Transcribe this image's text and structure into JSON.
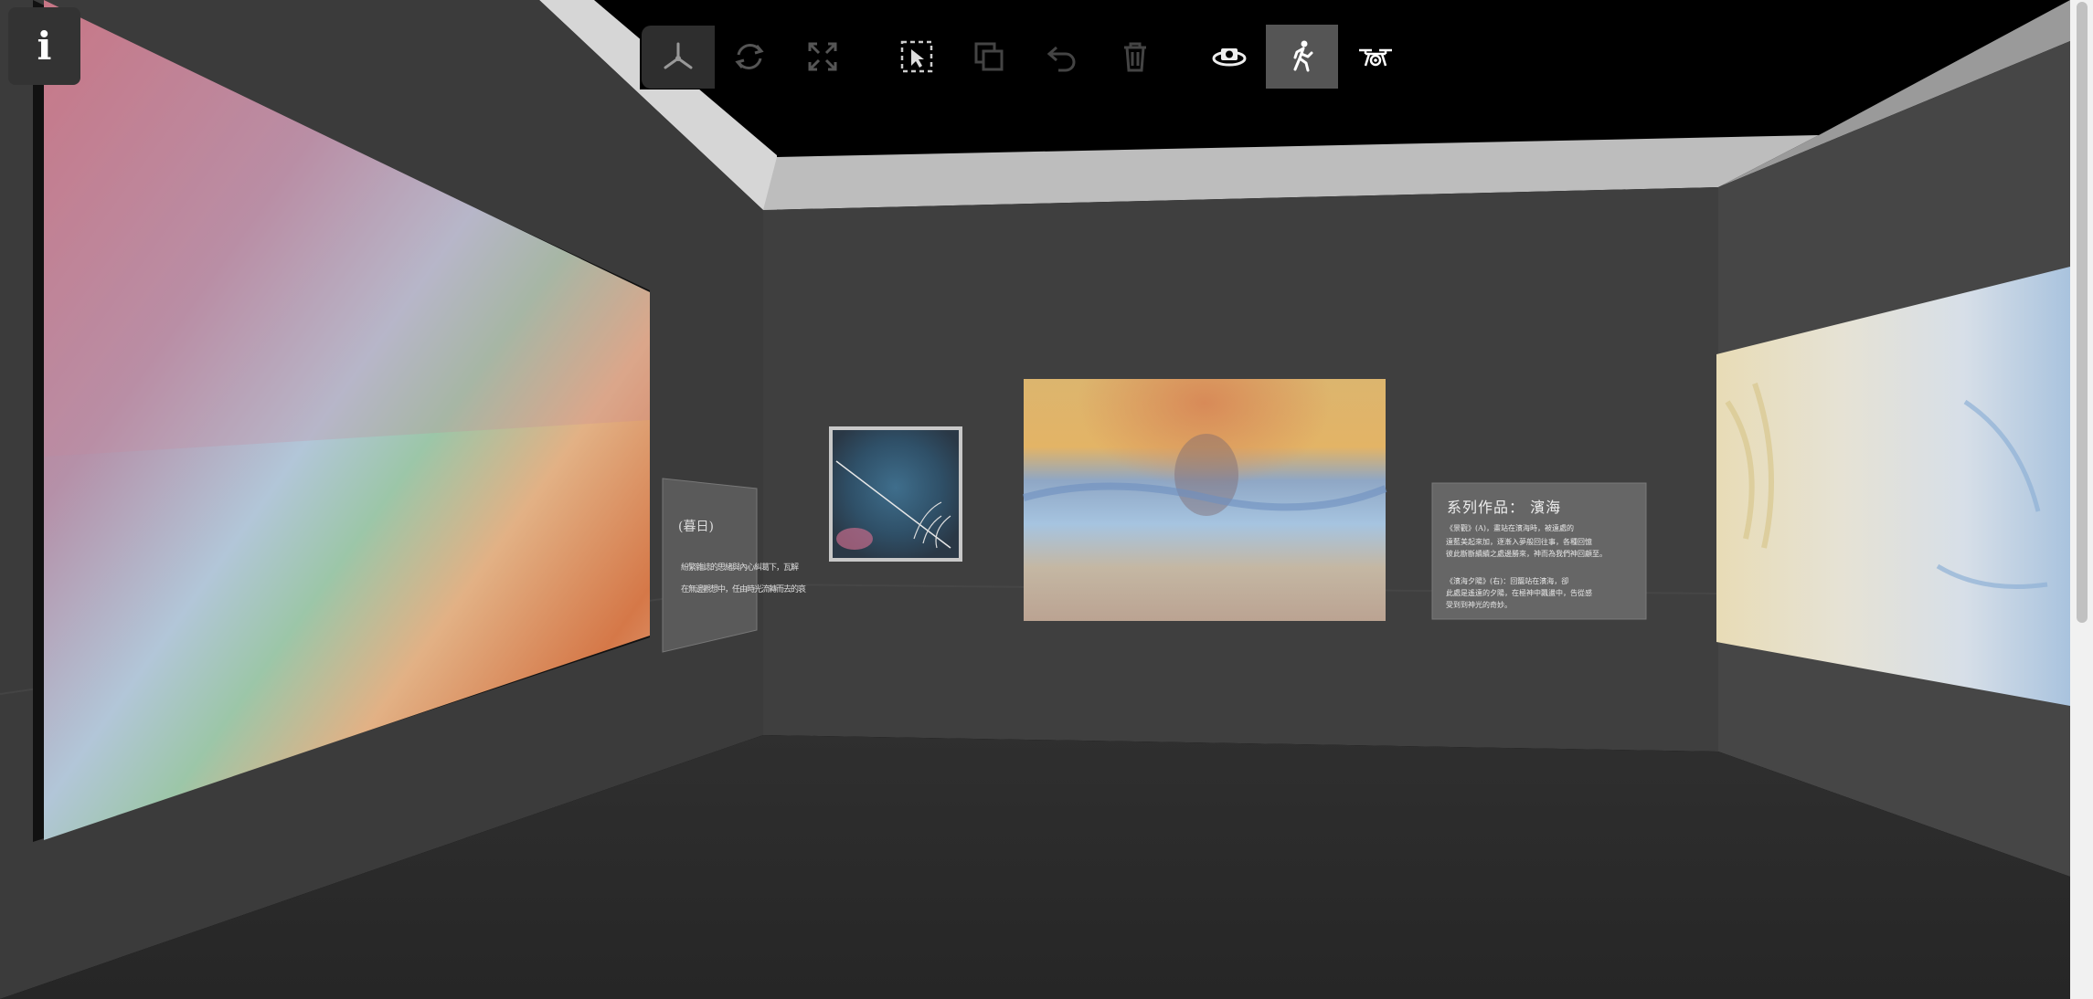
{
  "toolbar": {
    "info_label": "i",
    "buttons": [
      {
        "icon": "axes-icon",
        "enabled": true
      },
      {
        "icon": "rotate-icon",
        "enabled": false
      },
      {
        "icon": "fullscreen-icon",
        "enabled": false
      },
      {
        "icon": "select-icon",
        "enabled": true
      },
      {
        "icon": "duplicate-icon",
        "enabled": false
      },
      {
        "icon": "undo-icon",
        "enabled": false
      },
      {
        "icon": "delete-icon",
        "enabled": false
      },
      {
        "icon": "orbit-camera-icon",
        "enabled": true
      },
      {
        "icon": "walk-mode-icon",
        "enabled": true,
        "active": true
      },
      {
        "icon": "drone-icon",
        "enabled": true
      }
    ]
  },
  "placards": {
    "left": {
      "title": "(暮日)",
      "lines": [
        "紛繁雜誌的思緒與內心糾葛下，瓦解",
        "在無邊觀想中，任由時光流轉而去的哀"
      ]
    },
    "right": {
      "title": "系列作品： 濱海",
      "lines": [
        "《景觀》(A)，畫站在濱海時，被遠處的",
        "遠藍美起來加，逐漸入夢般回往事，各種回憶",
        "彼此斷斷續續之處邊勝來，神而為我們神回顧至。",
        "《濱海夕陽》(右)：回籠站在濱海，卻",
        "此處是遙遠的夕陽，在極神中飄盪中，告從感",
        "受到到神光的奇妙。"
      ]
    }
  },
  "colors": {
    "wall": "#3d3d3d",
    "floor": "#2a2a2a",
    "ceiling": "#bdbdbd",
    "toolbar_active": "#555555"
  }
}
